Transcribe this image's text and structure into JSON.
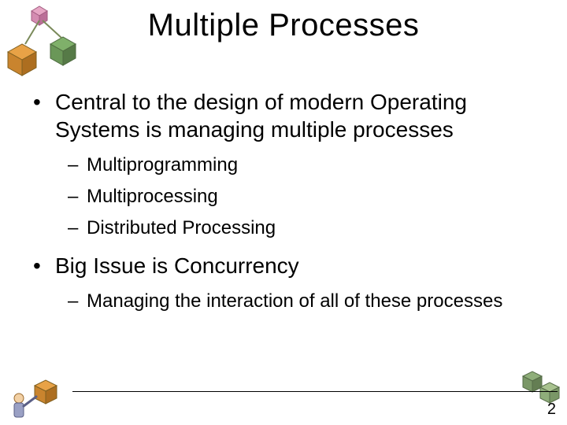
{
  "title": "Multiple  Processes",
  "bullets": {
    "b1": "Central to the design of modern Operating Systems is managing multiple processes",
    "b1a": "Multiprogramming",
    "b1b": "Multiprocessing",
    "b1c": "Distributed Processing",
    "b2": "Big Issue is Concurrency",
    "b2a": "Managing the interaction of all of these processes"
  },
  "page_number": "2",
  "icons": {
    "top_left": "decorative-cubes-top-left",
    "bottom_left": "decorative-person-cube-bottom-left",
    "bottom_right": "decorative-cubes-bottom-right"
  }
}
